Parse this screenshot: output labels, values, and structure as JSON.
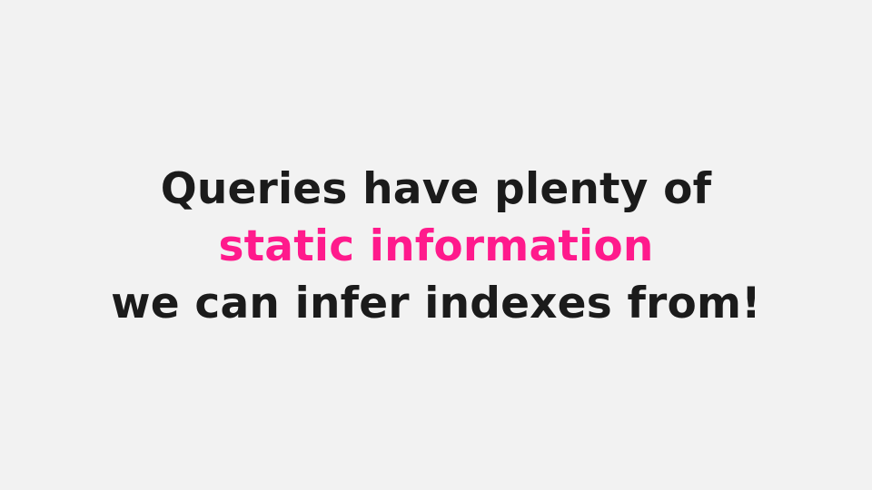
{
  "slide": {
    "lines": [
      "Queries have plenty of",
      "static information",
      "we can infer indexes from!"
    ],
    "colors": {
      "background": "#f2f2f2",
      "text": "#1b1b1b",
      "accent": "#ff1a8c"
    }
  }
}
